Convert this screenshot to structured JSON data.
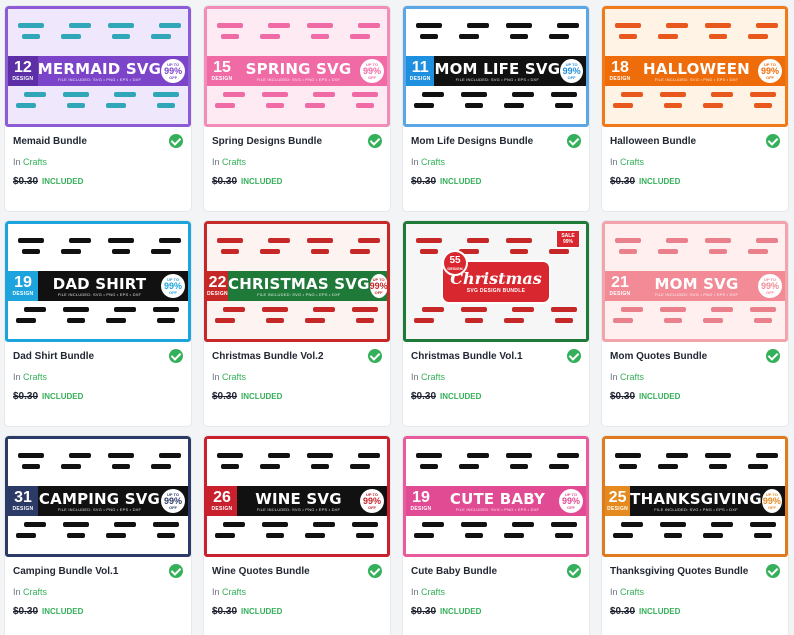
{
  "labels": {
    "in": "In",
    "included": "INCLUDED",
    "file_formats": "FILE INCLUDED: SVG • PNG • EPS • DXF",
    "up_to": "UP TO",
    "off": "OFF",
    "design_word": "DESIGN"
  },
  "products": [
    {
      "name": "Memaid Bundle",
      "category": "Crafts",
      "old_price": "$0.30",
      "count": "12",
      "banner": "MERMAID SVG",
      "discount": "99%",
      "style": "band",
      "theme": {
        "frame": "#8e5bd6",
        "band": "#7c45c9",
        "count": "#5c2fa6",
        "tile": "#2fa7b8",
        "bg": "#efe7fb",
        "badge": "#7c45c9"
      }
    },
    {
      "name": "Spring Designs Bundle",
      "category": "Crafts",
      "old_price": "$0.30",
      "count": "15",
      "banner": "SPRING SVG",
      "discount": "99%",
      "style": "band",
      "theme": {
        "frame": "#f28cb8",
        "band": "#f06aa6",
        "count": "#f06aa6",
        "tile": "#f06aa6",
        "bg": "#fdeaf2",
        "badge": "#f06aa6"
      }
    },
    {
      "name": "Mom Life Designs Bundle",
      "category": "Crafts",
      "old_price": "$0.30",
      "count": "11",
      "banner": "MOM LIFE SVG",
      "discount": "99%",
      "style": "band",
      "theme": {
        "frame": "#5aa6e6",
        "band": "#111111",
        "count": "#1f8fe0",
        "tile": "#111111",
        "bg": "#ffffff",
        "badge": "#1f8fe0"
      }
    },
    {
      "name": "Halloween Bundle",
      "category": "Crafts",
      "old_price": "$0.30",
      "count": "18",
      "banner": "HALLOWEEN",
      "discount": "99%",
      "style": "band",
      "theme": {
        "frame": "#f07a1a",
        "band": "#ef6c0a",
        "count": "#ef6c0a",
        "tile": "#e8581c",
        "bg": "#fff3e6",
        "badge": "#ef6c0a"
      }
    },
    {
      "name": "Dad Shirt Bundle",
      "category": "Crafts",
      "old_price": "$0.30",
      "count": "19",
      "banner": "DAD SHIRT",
      "discount": "99%",
      "style": "band",
      "theme": {
        "frame": "#1ea4dd",
        "band": "#111111",
        "count": "#1ea4dd",
        "tile": "#111111",
        "bg": "#ffffff",
        "badge": "#1ea4dd"
      }
    },
    {
      "name": "Christmas Bundle Vol.2",
      "category": "Crafts",
      "old_price": "$0.30",
      "count": "22",
      "banner": "CHRISTMAS SVG",
      "discount": "99%",
      "style": "band",
      "theme": {
        "frame": "#c62828",
        "band": "#1f7a3a",
        "count": "#c62828",
        "tile": "#c62828",
        "bg": "#fdf3f1",
        "badge": "#c62828"
      }
    },
    {
      "name": "Christmas Bundle Vol.1",
      "category": "Crafts",
      "old_price": "$0.30",
      "count": "55",
      "banner": "Christmas",
      "subtitle": "SVG DESIGN BUNDLE",
      "sale": "SALE",
      "discount": "99%",
      "style": "seal",
      "theme": {
        "frame": "#1f7a3a",
        "band": "#d8272f",
        "count": "#d8272f",
        "tile": "#c62828",
        "bg": "#f6f6f6",
        "badge": "#d8272f"
      }
    },
    {
      "name": "Mom Quotes Bundle",
      "category": "Crafts",
      "old_price": "$0.30",
      "count": "21",
      "banner": "MOM SVG",
      "discount": "99%",
      "style": "band",
      "theme": {
        "frame": "#f3a3ac",
        "band": "#f28b96",
        "count": "#f28b96",
        "tile": "#e9808b",
        "bg": "#fff0ef",
        "badge": "#f28b96"
      }
    },
    {
      "name": "Camping Bundle Vol.1",
      "category": "Crafts",
      "old_price": "$0.30",
      "count": "31",
      "banner": "CAMPING SVG",
      "discount": "99%",
      "style": "band",
      "theme": {
        "frame": "#2b3a67",
        "band": "#111111",
        "count": "#2b3a67",
        "tile": "#111111",
        "bg": "#ffffff",
        "badge": "#2b3a67"
      }
    },
    {
      "name": "Wine Quotes Bundle",
      "category": "Crafts",
      "old_price": "$0.30",
      "count": "26",
      "banner": "WINE SVG",
      "discount": "99%",
      "style": "band",
      "theme": {
        "frame": "#c8202c",
        "band": "#111111",
        "count": "#c8202c",
        "tile": "#111111",
        "bg": "#ffffff",
        "badge": "#c8202c"
      }
    },
    {
      "name": "Cute Baby Bundle",
      "category": "Crafts",
      "old_price": "$0.30",
      "count": "19",
      "banner": "CUTE BABY",
      "discount": "99%",
      "style": "band",
      "theme": {
        "frame": "#e85b9c",
        "band": "#e04b93",
        "count": "#e04b93",
        "tile": "#111111",
        "bg": "#ffffff",
        "badge": "#e04b93"
      }
    },
    {
      "name": "Thanksgiving Quotes Bundle",
      "category": "Crafts",
      "old_price": "$0.30",
      "count": "25",
      "banner": "THANKSGIVING",
      "discount": "99%",
      "style": "band",
      "theme": {
        "frame": "#e07a1f",
        "band": "#111111",
        "count": "#e58a1e",
        "tile": "#111111",
        "bg": "#ffffff",
        "badge": "#e58a1e"
      }
    }
  ]
}
